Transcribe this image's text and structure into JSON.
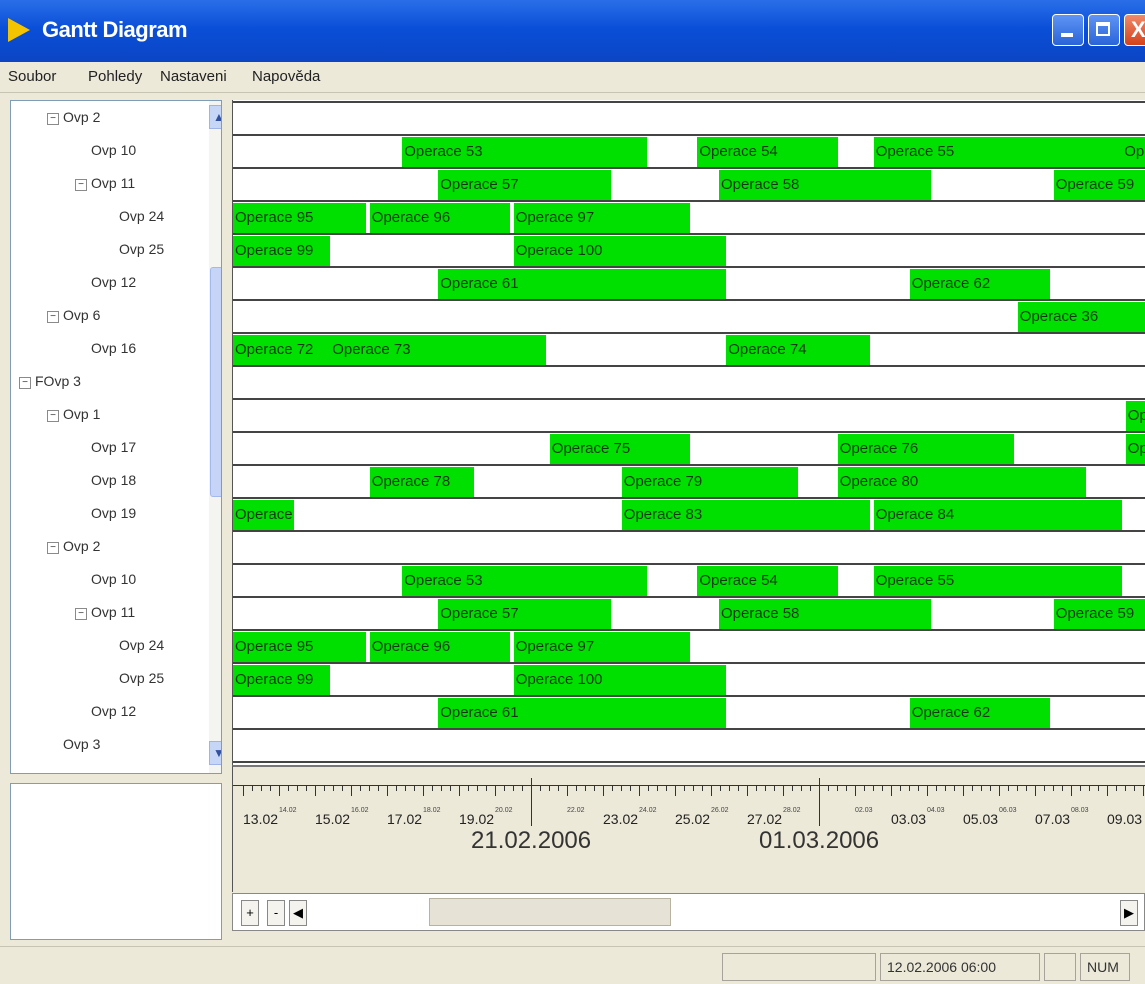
{
  "window": {
    "title": "Gantt Diagram",
    "close_glyph": "X"
  },
  "menu": [
    "Soubor",
    "Pohledy",
    "Nastaveni",
    "Napověda"
  ],
  "tree": [
    {
      "label": "Ovp 2",
      "toggle": "-",
      "depth": 1
    },
    {
      "label": "Ovp 10",
      "toggle": "",
      "depth": 2
    },
    {
      "label": "Ovp 11",
      "toggle": "-",
      "depth": 2
    },
    {
      "label": "Ovp 24",
      "toggle": "",
      "depth": 3
    },
    {
      "label": "Ovp 25",
      "toggle": "",
      "depth": 3
    },
    {
      "label": "Ovp 12",
      "toggle": "",
      "depth": 2
    },
    {
      "label": "Ovp 6",
      "toggle": "-",
      "depth": 1
    },
    {
      "label": "Ovp 16",
      "toggle": "",
      "depth": 2
    },
    {
      "label": "FOvp 3",
      "toggle": "-",
      "depth": 0
    },
    {
      "label": "Ovp 1",
      "toggle": "-",
      "depth": 1
    },
    {
      "label": "Ovp 17",
      "toggle": "",
      "depth": 2
    },
    {
      "label": "Ovp 18",
      "toggle": "",
      "depth": 2
    },
    {
      "label": "Ovp 19",
      "toggle": "",
      "depth": 2
    },
    {
      "label": "Ovp 2",
      "toggle": "-",
      "depth": 1
    },
    {
      "label": "Ovp 10",
      "toggle": "",
      "depth": 2
    },
    {
      "label": "Ovp 11",
      "toggle": "-",
      "depth": 2
    },
    {
      "label": "Ovp 24",
      "toggle": "",
      "depth": 3
    },
    {
      "label": "Ovp 25",
      "toggle": "",
      "depth": 3
    },
    {
      "label": "Ovp 12",
      "toggle": "",
      "depth": 2
    },
    {
      "label": "Ovp 3",
      "toggle": "",
      "depth": 1
    }
  ],
  "tree_scroll": {
    "up": "▲",
    "down": "▼"
  },
  "bar_color": "#00e000",
  "gantt_rows": [
    [
      {
        "label": "Operace 53",
        "start": 0.0,
        "end": 0.0
      }
    ],
    [],
    [],
    [],
    [],
    [],
    [],
    [],
    [],
    [],
    [],
    [],
    [],
    [],
    [],
    [],
    [],
    [],
    [],
    []
  ],
  "timeline": {
    "dates": [
      "13.02",
      "15.02",
      "17.02",
      "19.02",
      "23.02",
      "25.02",
      "27.02",
      "03.03",
      "05.03",
      "07.03",
      "09.03"
    ],
    "minor_dates": [
      "14.02",
      "16.02",
      "18.02",
      "20.02",
      "22.02",
      "24.02",
      "26.02",
      "28.02",
      "02.03",
      "04.03",
      "06.03",
      "08.03"
    ],
    "major_dates": [
      "21.02.2006",
      "01.03.2006"
    ]
  },
  "hscroll": {
    "zoom_in": "+",
    "zoom_out": "-",
    "left": "◀",
    "right": "▶"
  },
  "status": {
    "datetime": "12.02.2006 06:00",
    "num": "NUM"
  }
}
